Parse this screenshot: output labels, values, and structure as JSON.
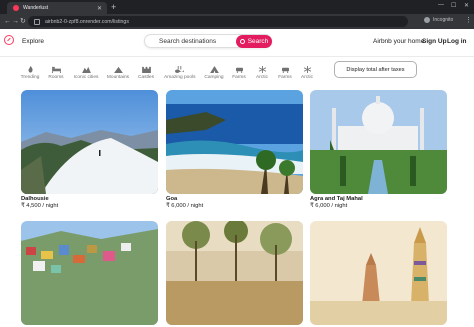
{
  "browser": {
    "tab_title": "Wanderlust",
    "url": "airbnb2-0-zpf8.onrender.com/listings",
    "incognito_label": "Incognito"
  },
  "header": {
    "explore_label": "Explore",
    "search_placeholder": "Search destinations",
    "search_button": "Search",
    "host_link": "Airbnb your home",
    "signup": "Sign Up",
    "login": "Log in"
  },
  "categories": [
    {
      "label": "Trending",
      "icon": "fire-icon"
    },
    {
      "label": "Rooms",
      "icon": "bed-icon"
    },
    {
      "label": "Iconic cities",
      "icon": "mountain-city-icon"
    },
    {
      "label": "Mountains",
      "icon": "mountain-icon"
    },
    {
      "label": "Castles",
      "icon": "castle-icon"
    },
    {
      "label": "Amazing pools",
      "icon": "pool-icon"
    },
    {
      "label": "Camping",
      "icon": "campground-icon"
    },
    {
      "label": "Farms",
      "icon": "cow-icon"
    },
    {
      "label": "Arctic",
      "icon": "snowflake-icon"
    },
    {
      "label": "Farms",
      "icon": "cow-icon"
    },
    {
      "label": "Arctic",
      "icon": "snowflake-icon"
    }
  ],
  "tax_toggle_label": "Display total after taxes",
  "listings": [
    {
      "title": "Dalhousie",
      "price": "₹ 4,500 / night"
    },
    {
      "title": "Goa",
      "price": "₹ 6,000 / night"
    },
    {
      "title": "Agra and Taj Mahal",
      "price": "₹ 6,000 / night"
    },
    {
      "title": "",
      "price": ""
    },
    {
      "title": "",
      "price": ""
    },
    {
      "title": "",
      "price": ""
    }
  ],
  "colors": {
    "accent": "#e31c5f",
    "brand": "#ff385c"
  }
}
